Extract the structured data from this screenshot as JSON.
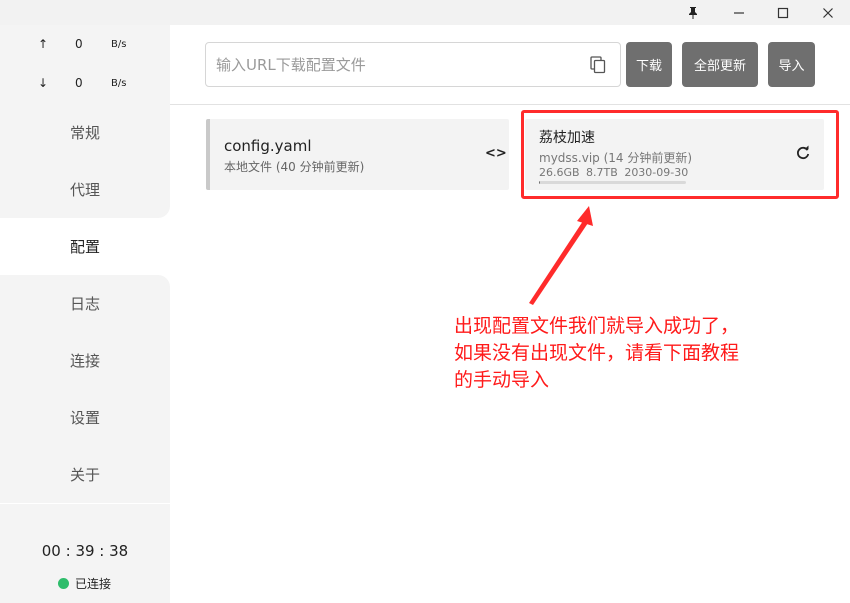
{
  "window_controls": {
    "pin": "pin-icon",
    "minimize": "minimize-icon",
    "maximize": "maximize-icon",
    "close": "close-icon"
  },
  "traffic": {
    "up": {
      "arrow": "↑",
      "value": "0",
      "unit": "B/s"
    },
    "down": {
      "arrow": "↓",
      "value": "0",
      "unit": "B/s"
    }
  },
  "nav": {
    "items": [
      {
        "label": "常规"
      },
      {
        "label": "代理"
      },
      {
        "label": "配置",
        "active": true
      },
      {
        "label": "日志"
      },
      {
        "label": "连接"
      },
      {
        "label": "设置"
      },
      {
        "label": "关于"
      }
    ]
  },
  "status": {
    "clock": "00 : 39 : 38",
    "connection": "已连接",
    "connection_color": "#2ebd6b"
  },
  "toolbar": {
    "url_placeholder": "输入URL下载配置文件",
    "url_value": "",
    "download_label": "下载",
    "update_all_label": "全部更新",
    "import_label": "导入"
  },
  "profiles": [
    {
      "name": "config.yaml",
      "detail": "本地文件 (40 分钟前更新)",
      "action_icon": "code-icon"
    },
    {
      "name": "荔枝加速",
      "detail": "mydss.vip (14 分钟前更新)",
      "meta": "26.6GB 8.7TB 2030-09-30",
      "usage_fraction": 0.003,
      "action_icon": "refresh-icon"
    }
  ],
  "annotation": {
    "color": "#ff1a1a",
    "lines": [
      "出现配置文件我们就导入成功了，",
      "如果没有出现文件，请看下面教程",
      "的手动导入"
    ]
  }
}
